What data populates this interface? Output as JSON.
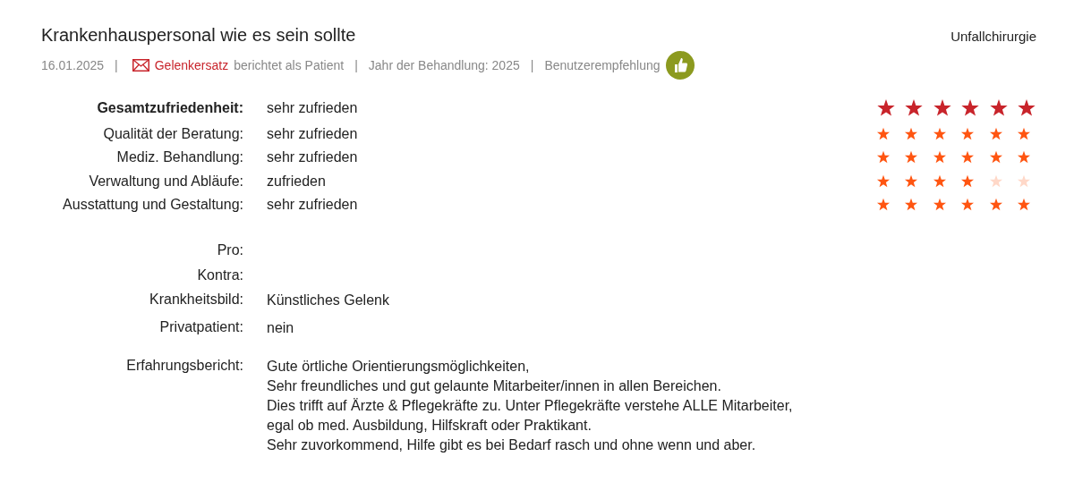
{
  "review": {
    "title": "Krankenhauspersonal wie es sein sollte",
    "department": "Unfallchirurgie",
    "meta": {
      "date": "16.01.2025",
      "separator": "|",
      "author": "Gelenkersatz",
      "author_role": "berichtet als Patient",
      "treatment_year": "Jahr der Behandlung: 2025",
      "recommendation": "Benutzerempfehlung"
    },
    "ratings": [
      {
        "kind": "overall",
        "label": "Gesamtzufriedenheit:",
        "value": "sehr zufrieden",
        "stars": 6
      },
      {
        "kind": "detail",
        "label": "Qualität der Beratung:",
        "value": "sehr zufrieden",
        "stars": 6
      },
      {
        "kind": "detail",
        "label": "Mediz. Behandlung:",
        "value": "sehr zufrieden",
        "stars": 6
      },
      {
        "kind": "detail",
        "label": "Verwaltung und Abläufe:",
        "value": "zufrieden",
        "stars": 4
      },
      {
        "kind": "detail",
        "label": "Ausstattung und Gestaltung:",
        "value": "sehr zufrieden",
        "stars": 6
      }
    ],
    "details": [
      {
        "label": "Pro:"
      },
      {
        "label": "Kontra:"
      },
      {
        "label": "Krankheitsbild:",
        "lines": [
          "Künstliches Gelenk"
        ]
      },
      {
        "label": "Privatpatient:",
        "lines": [
          "nein"
        ]
      },
      {
        "label": "Erfahrungsbericht:",
        "lines": [
          "Gute örtliche Orientierungsmöglichkeiten,",
          "Sehr freundliches und gut gelaunte Mitarbeiter/innen in allen Bereichen.",
          "Dies trifft auf Ärzte & Pflegekräfte zu. Unter Pflegekräfte verstehe ALLE Mitarbeiter,",
          "egal ob med. Ausbildung, Hilfskraft oder Praktikant.",
          "Sehr zuvorkommend, Hilfe gibt es bei Bedarf rasch und ohne wenn und aber."
        ]
      }
    ]
  }
}
